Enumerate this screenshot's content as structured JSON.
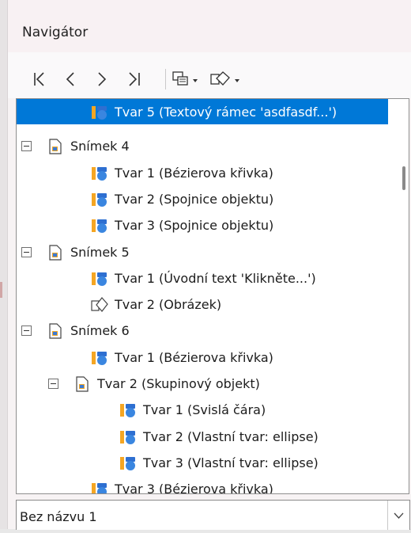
{
  "window": {
    "title": "Navigátor"
  },
  "toolbar": {
    "icons": [
      "first-icon",
      "previous-icon",
      "next-icon",
      "last-icon",
      "drag-mode-icon",
      "shape-filter-icon"
    ]
  },
  "tree": {
    "rows": [
      {
        "label": "Tvar 5 (Textový rámec 'asdfasdf...')",
        "icon": "shape-icon",
        "selected": true
      },
      {
        "label": "Snímek 4",
        "icon": "slide-icon",
        "expander": true
      },
      {
        "label": "Tvar 1 (Bézierova křivka)",
        "icon": "shape-icon"
      },
      {
        "label": "Tvar 2 (Spojnice objektu)",
        "icon": "shape-icon"
      },
      {
        "label": "Tvar 3 (Spojnice objektu)",
        "icon": "shape-icon"
      },
      {
        "label": "Snímek 5",
        "icon": "slide-icon",
        "expander": true
      },
      {
        "label": "Tvar 1 (Úvodní text 'Klikněte...')",
        "icon": "shape-icon"
      },
      {
        "label": "Tvar 2 (Obrázek)",
        "icon": "image-icon"
      },
      {
        "label": "Snímek 6",
        "icon": "slide-icon",
        "expander": true
      },
      {
        "label": "Tvar 1 (Bézierova křivka)",
        "icon": "shape-icon"
      },
      {
        "label": "Tvar 2 (Skupinový objekt)",
        "icon": "group-icon",
        "expander": true
      },
      {
        "label": "Tvar 1 (Svislá čára)",
        "icon": "shape-icon"
      },
      {
        "label": "Tvar 2 (Vlastní tvar: ellipse)",
        "icon": "shape-icon"
      },
      {
        "label": "Tvar 3 (Vlastní tvar: ellipse)",
        "icon": "shape-icon"
      },
      {
        "label": "Tvar 3 (Bézierova křivka)",
        "icon": "shape-icon"
      }
    ]
  },
  "document_select": {
    "value": "Bez názvu 1"
  },
  "colors": {
    "selection": "#0078d7",
    "shape_orange": "#f5a623",
    "shape_blue": "#3a7bd5"
  }
}
